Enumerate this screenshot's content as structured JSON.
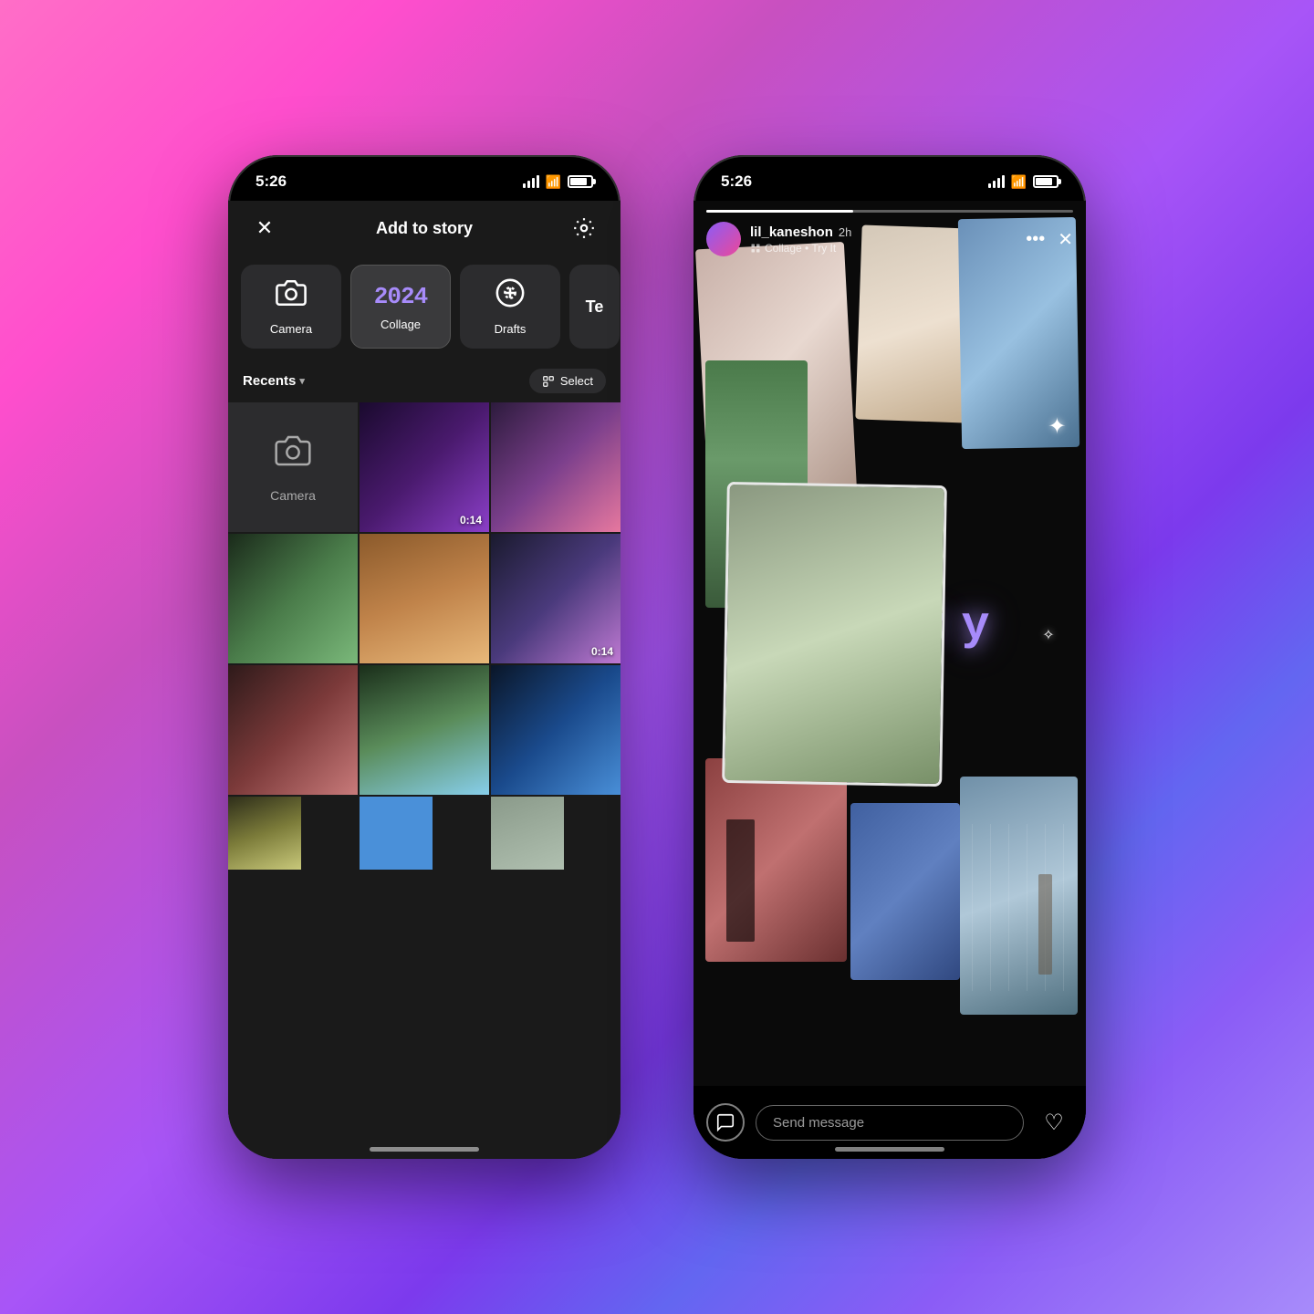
{
  "background": {
    "gradient_start": "#ff6ec7",
    "gradient_end": "#6366f1"
  },
  "left_phone": {
    "status_bar": {
      "time": "5:26"
    },
    "top_bar": {
      "title": "Add to story",
      "close_label": "×",
      "settings_label": "⚙"
    },
    "tools": {
      "camera": {
        "label": "Camera",
        "icon": "camera"
      },
      "collage": {
        "label": "Collage",
        "icon_text": "2024"
      },
      "drafts": {
        "label": "Drafts",
        "icon": "drafts"
      },
      "partial": {
        "label": "Te"
      }
    },
    "recents": {
      "label": "Recents",
      "select_label": "Select"
    },
    "photos": {
      "camera_label": "Camera",
      "video1_duration": "0:14",
      "video2_duration": "0:14"
    }
  },
  "right_phone": {
    "status_bar": {
      "time": "5:26"
    },
    "story": {
      "username": "lil_kaneshon",
      "time": "2h",
      "subtitle": "Collage • Try It",
      "hny_text": "hh:n:y",
      "more_label": "•••",
      "close_label": "×"
    },
    "bottom_bar": {
      "message_placeholder": "Send message",
      "heart_label": "♡"
    }
  }
}
